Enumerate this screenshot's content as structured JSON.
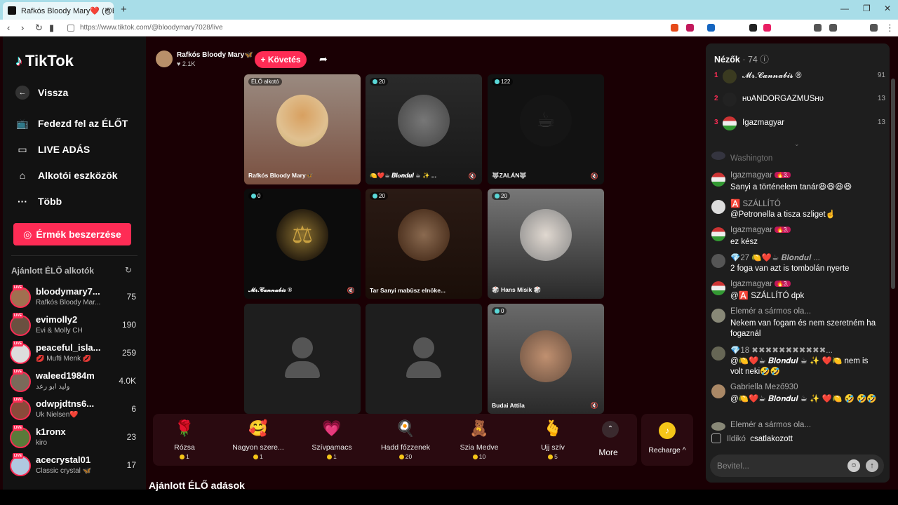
{
  "browser": {
    "tab_title": "Rafkós Bloody Mary❤️ (@bl",
    "url": "https://www.tiktok.com/@bloodymary7028/live",
    "new_tab": "+",
    "close": "×"
  },
  "sidebar": {
    "logo": "TikTok",
    "nav": [
      {
        "label": "Vissza",
        "icon": "back-arrow-icon"
      },
      {
        "label": "Fedezd fel az ÉLŐT",
        "icon": "tv-icon"
      },
      {
        "label": "LIVE ADÁS",
        "icon": "camera-icon"
      },
      {
        "label": "Alkotói eszközök",
        "icon": "creator-tools-icon"
      },
      {
        "label": "Több",
        "icon": "more-dots-icon"
      }
    ],
    "coins_button": "Érmék beszerzése",
    "recommended_title": "Ajánlott ÉLŐ alkotók",
    "creators": [
      {
        "name": "bloodymary7...",
        "sub": "Rafkós Bloody Mar...",
        "count": "75"
      },
      {
        "name": "evimolly2",
        "sub": "Évi & Molly CH",
        "count": "190"
      },
      {
        "name": "peaceful_isla...",
        "sub": "💋 Mufti Menk 💋",
        "count": "259"
      },
      {
        "name": "waleed1984m",
        "sub": "وليد ابو رعد",
        "count": "4.0K"
      },
      {
        "name": "odwpjdtns6...",
        "sub": "Uk Nielsen❤️",
        "count": "6"
      },
      {
        "name": "k1ronx",
        "sub": "kiro",
        "count": "23"
      },
      {
        "name": "acecrystal01",
        "sub": "Classic crystal 🦋",
        "count": "17"
      }
    ],
    "live_badge": "LIVE"
  },
  "host": {
    "name": "Rafkós Bloody Mary🦋",
    "likes": "♥ 2.1K",
    "follow": "+ Követés"
  },
  "tiles": [
    {
      "badge": "ÉLŐ alkotó",
      "caption": "Rafkós Bloody Mary🦋",
      "muted": false
    },
    {
      "badge": "20",
      "caption": "🍋❤️☕ 𝑩𝒍𝒐𝒏𝒅𝒖𝒍 ☕ ✨ ...",
      "muted": true
    },
    {
      "badge": "122",
      "caption": "🐺ZALÁN🐺",
      "muted": true
    },
    {
      "badge": "0",
      "caption": "𝓜𝓻.𝓒𝓪𝓷𝓷𝓪𝓫𝓲𝓼 ®",
      "muted": true
    },
    {
      "badge": "20",
      "caption": "Tar Sanyi mabüsz elnöke...",
      "muted": false
    },
    {
      "badge": "20",
      "caption": "🎲 Hans Misik 🎲",
      "muted": false
    },
    {
      "badge": "",
      "caption": "",
      "muted": false
    },
    {
      "badge": "",
      "caption": "",
      "muted": false
    },
    {
      "badge": "0",
      "caption": "Budai Attila",
      "muted": true
    }
  ],
  "gifts": [
    {
      "name": "Rózsa",
      "cost": "1",
      "icon": "rose-icon",
      "glyph": "🌹"
    },
    {
      "name": "Nagyon szere...",
      "cost": "1",
      "icon": "love-face-icon",
      "glyph": "🥰"
    },
    {
      "name": "Szívpamacs",
      "cost": "1",
      "icon": "heart-puff-icon",
      "glyph": "💗"
    },
    {
      "name": "Hadd főzzenek",
      "cost": "20",
      "icon": "cook-icon",
      "glyph": "🍳"
    },
    {
      "name": "Szia Medve",
      "cost": "10",
      "icon": "bear-icon",
      "glyph": "🧸"
    },
    {
      "name": "Ujj szív",
      "cost": "5",
      "icon": "finger-heart-icon",
      "glyph": "🫰"
    }
  ],
  "more_label": "More",
  "recharge_label": "Recharge ^",
  "section_title": "Ajánlott ÉLŐ adások",
  "viewers": {
    "title": "Nézők",
    "count": "· 74",
    "list": [
      {
        "rank": "1",
        "name": "𝓜𝓻.𝓒𝓪𝓷𝓷𝓪𝓫𝓲𝓼 ®",
        "score": "91"
      },
      {
        "rank": "2",
        "name": "ʜᴜANDORGAZMUSʜᴜ",
        "score": "13"
      },
      {
        "rank": "3",
        "name": "Igazmagyar",
        "score": "13"
      }
    ]
  },
  "chat": [
    {
      "name": "Washington",
      "text": ""
    },
    {
      "name": "Igazmagyar",
      "level": "🔥3.",
      "text": "Sanyi a történelem tanár😆😆😆😆"
    },
    {
      "name": "🅰️ SZÁLLÍTÓ",
      "text": "@Petronella a tisza szliget☝️"
    },
    {
      "name": "Igazmagyar",
      "level": "🔥3.",
      "text": "ez kész"
    },
    {
      "name": "💎27 🍋❤️☕ 𝑩𝒍𝒐𝒏𝒅𝒖𝒍 ...",
      "text": "2 foga van azt is tombolán nyerte"
    },
    {
      "name": "Igazmagyar",
      "level": "🔥3.",
      "text": "@🅰️ SZÁLLÍTÓ dpk"
    },
    {
      "name": "Elemér a sármos ola...",
      "text": "Nekem van fogam és nem szeretném ha fogaznál"
    },
    {
      "name": "💎18 ✖✖✖✖✖✖✖✖✖✖✖...",
      "text": "@🍋❤️☕ 𝑩𝒍𝒐𝒏𝒅𝒖𝒍 ☕ ✨ ❤️🍋 nem is volt neki🤣🤣"
    },
    {
      "name": "Gabriella Mező930",
      "text": "@🍋❤️☕ 𝑩𝒍𝒐𝒏𝒅𝒖𝒍 ☕ ✨ ❤️🍋 🤣 🤣🤣"
    },
    {
      "name": "Elemér a sármos ola...",
      "text": ""
    }
  ],
  "join": {
    "name": "Ildikó",
    "text": "csatlakozott"
  },
  "input_placeholder": "Bevitel..."
}
